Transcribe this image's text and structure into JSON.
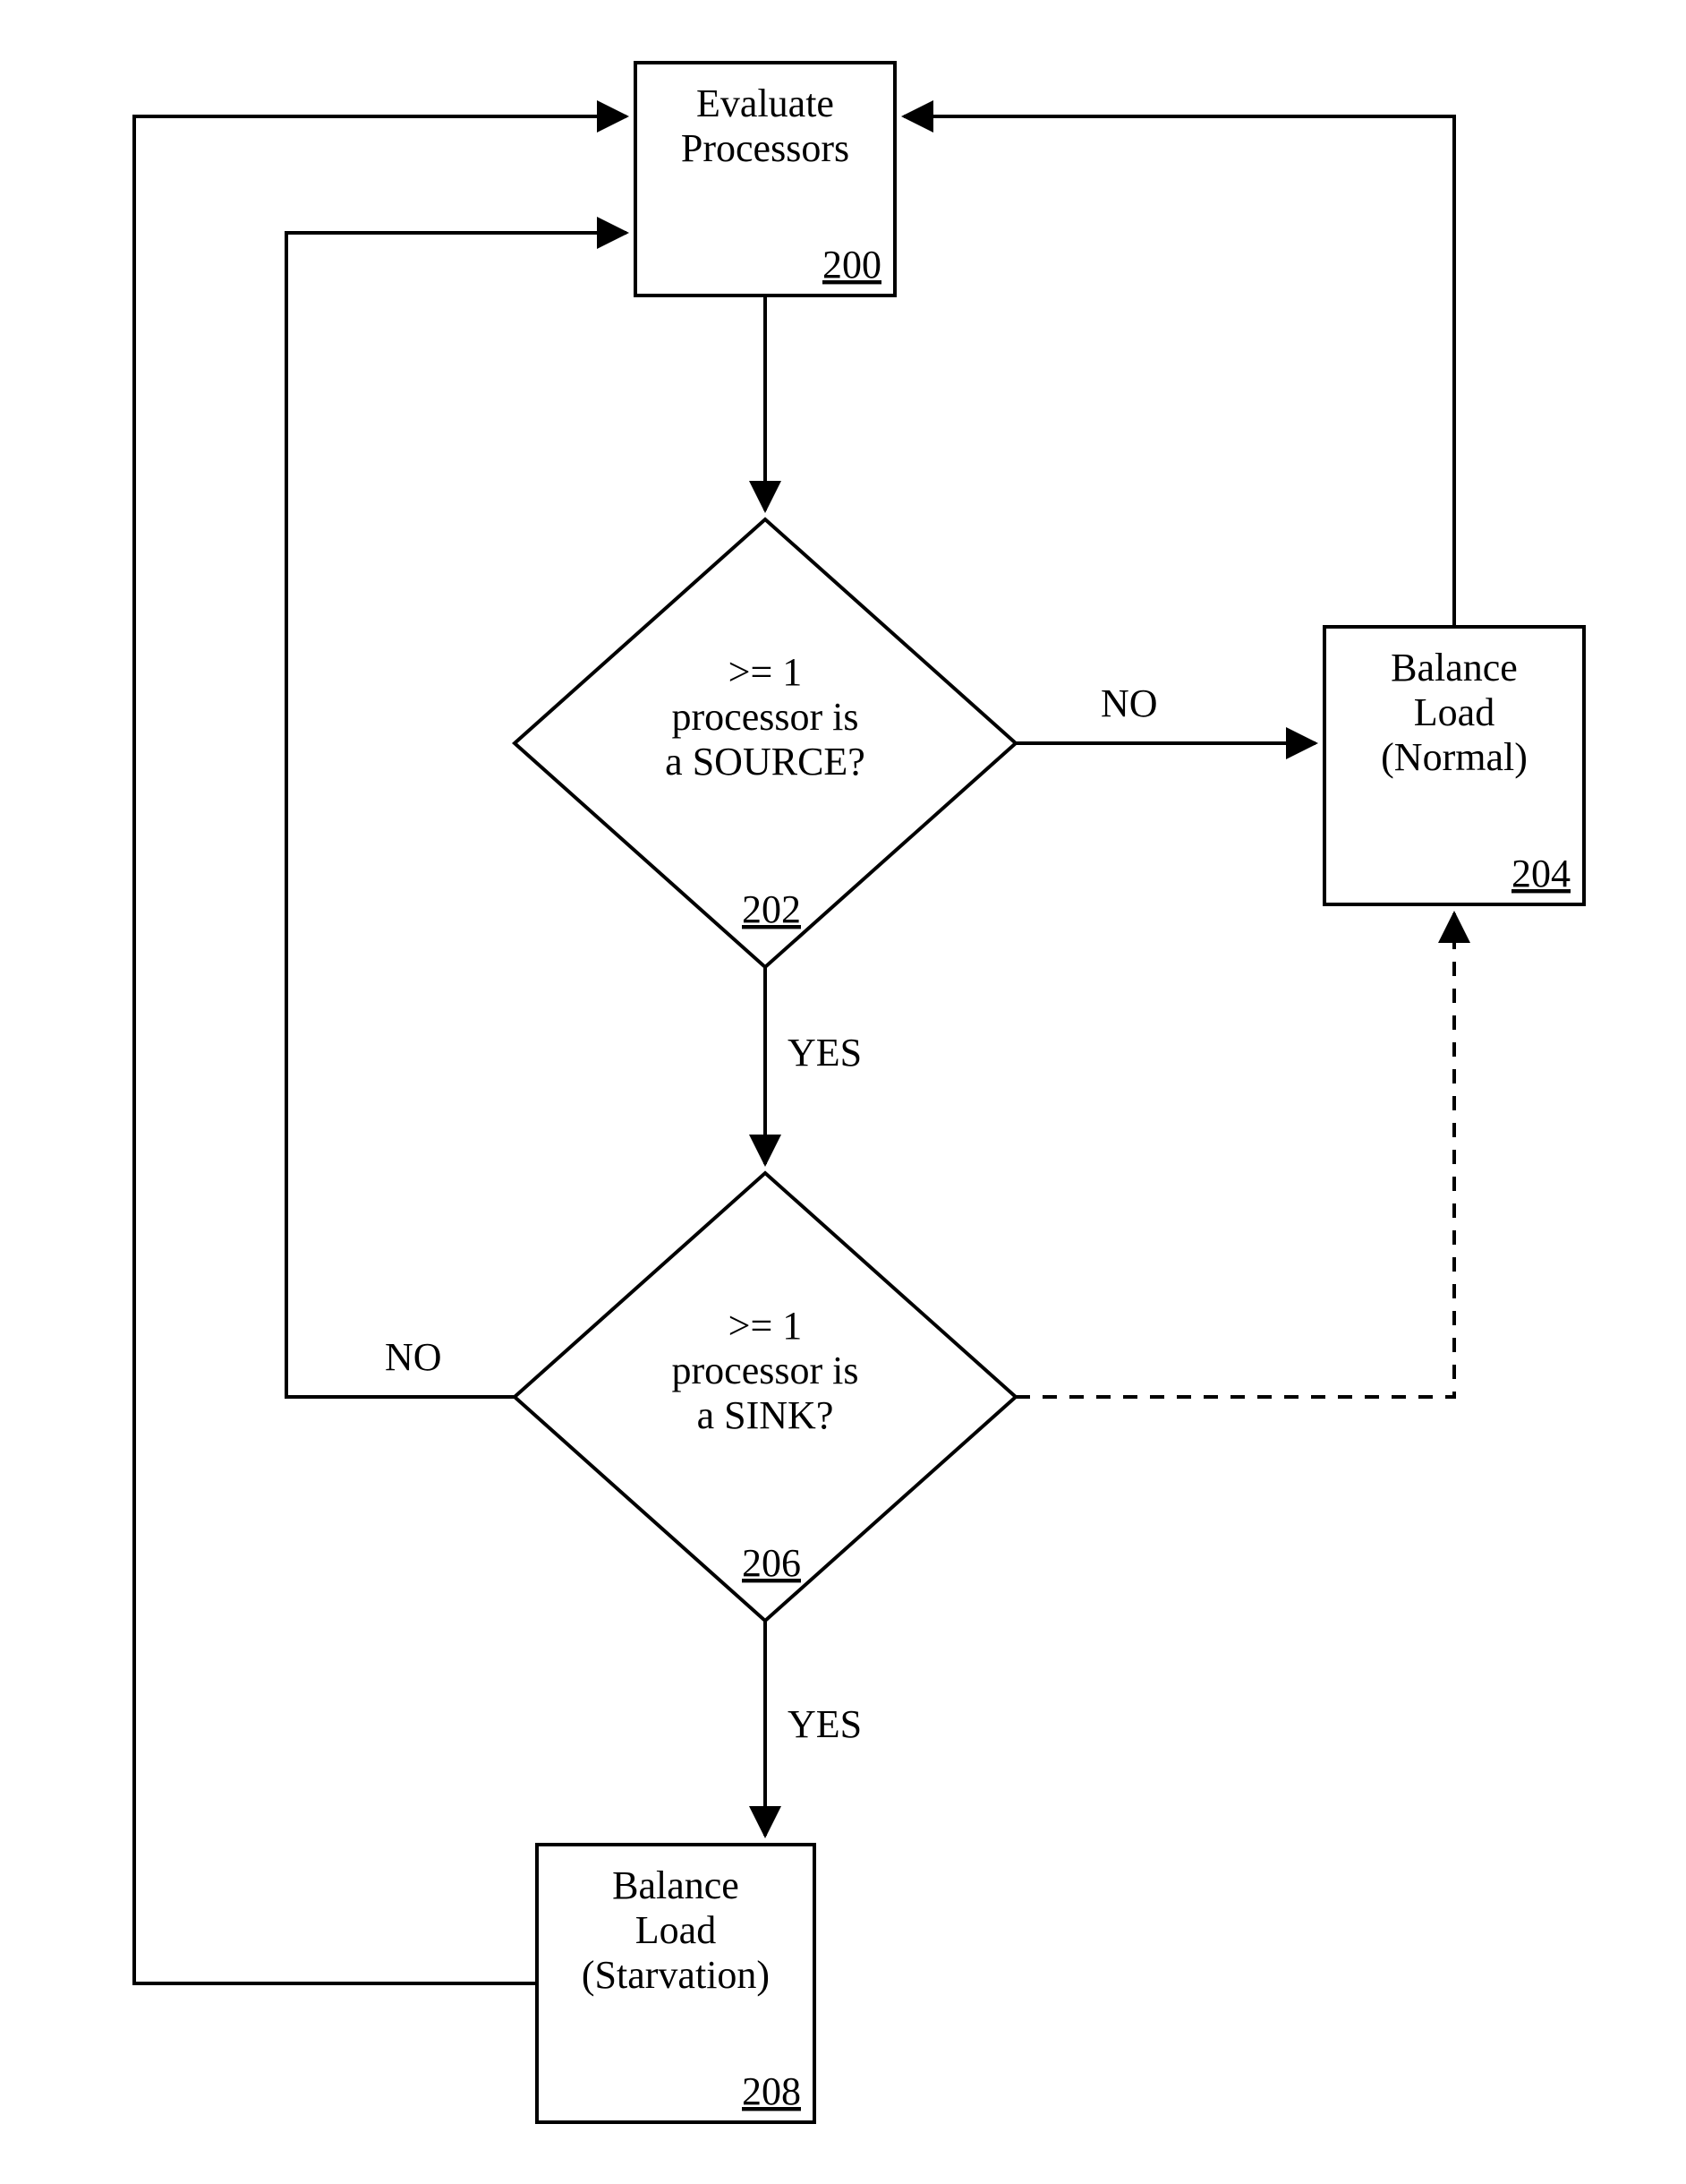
{
  "nodes": {
    "evaluate": {
      "line1": "Evaluate",
      "line2": "Processors",
      "ref": "200"
    },
    "sourceCheck": {
      "line1": ">= 1",
      "line2": "processor is",
      "line3": "a SOURCE?",
      "ref": "202"
    },
    "balanceNormal": {
      "line1": "Balance",
      "line2": "Load",
      "line3": "(Normal)",
      "ref": "204"
    },
    "sinkCheck": {
      "line1": ">= 1",
      "line2": "processor is",
      "line3": "a SINK?",
      "ref": "206"
    },
    "balanceStarvation": {
      "line1": "Balance",
      "line2": "Load",
      "line3": "(Starvation)",
      "ref": "208"
    }
  },
  "edgeLabels": {
    "sourceNo": "NO",
    "sourceYes": "YES",
    "sinkNo": "NO",
    "sinkYes": "YES"
  }
}
